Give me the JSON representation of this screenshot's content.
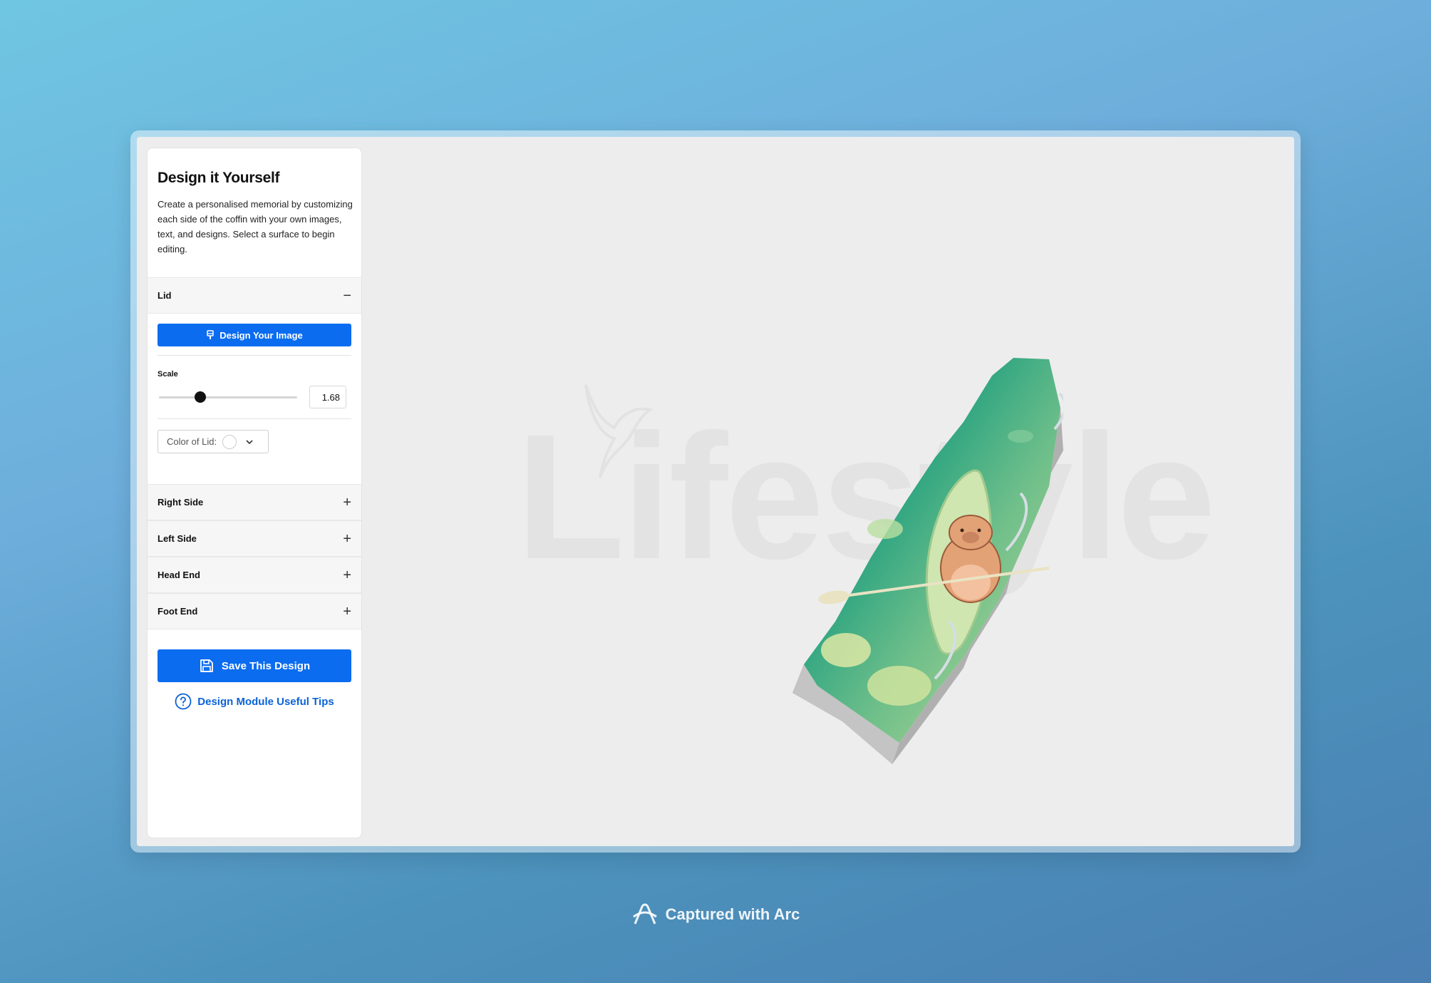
{
  "sidebar": {
    "title": "Design it Yourself",
    "description": "Create a personalised memorial by customizing each side of the coffin with your own images, text, and designs. Select a surface to begin editing.",
    "sections": [
      {
        "label": "Lid",
        "toggle": "−"
      },
      {
        "label": "Right Side",
        "toggle": "+"
      },
      {
        "label": "Left Side",
        "toggle": "+"
      },
      {
        "label": "Head End",
        "toggle": "+"
      },
      {
        "label": "Foot End",
        "toggle": "+"
      }
    ],
    "lid": {
      "design_button": "Design Your Image",
      "scale_label": "Scale",
      "scale_value": "1.68",
      "scale_fraction": 0.3,
      "color_label": "Color of Lid:",
      "color_value": "#ffffff"
    },
    "save_button": "Save This Design",
    "tips_link": "Design Module Useful Tips"
  },
  "viewport": {
    "watermark": "Lifestyle"
  },
  "footer": {
    "text": "Captured with Arc"
  },
  "colors": {
    "accent": "#0b6cf0",
    "link": "#0b62d8"
  }
}
